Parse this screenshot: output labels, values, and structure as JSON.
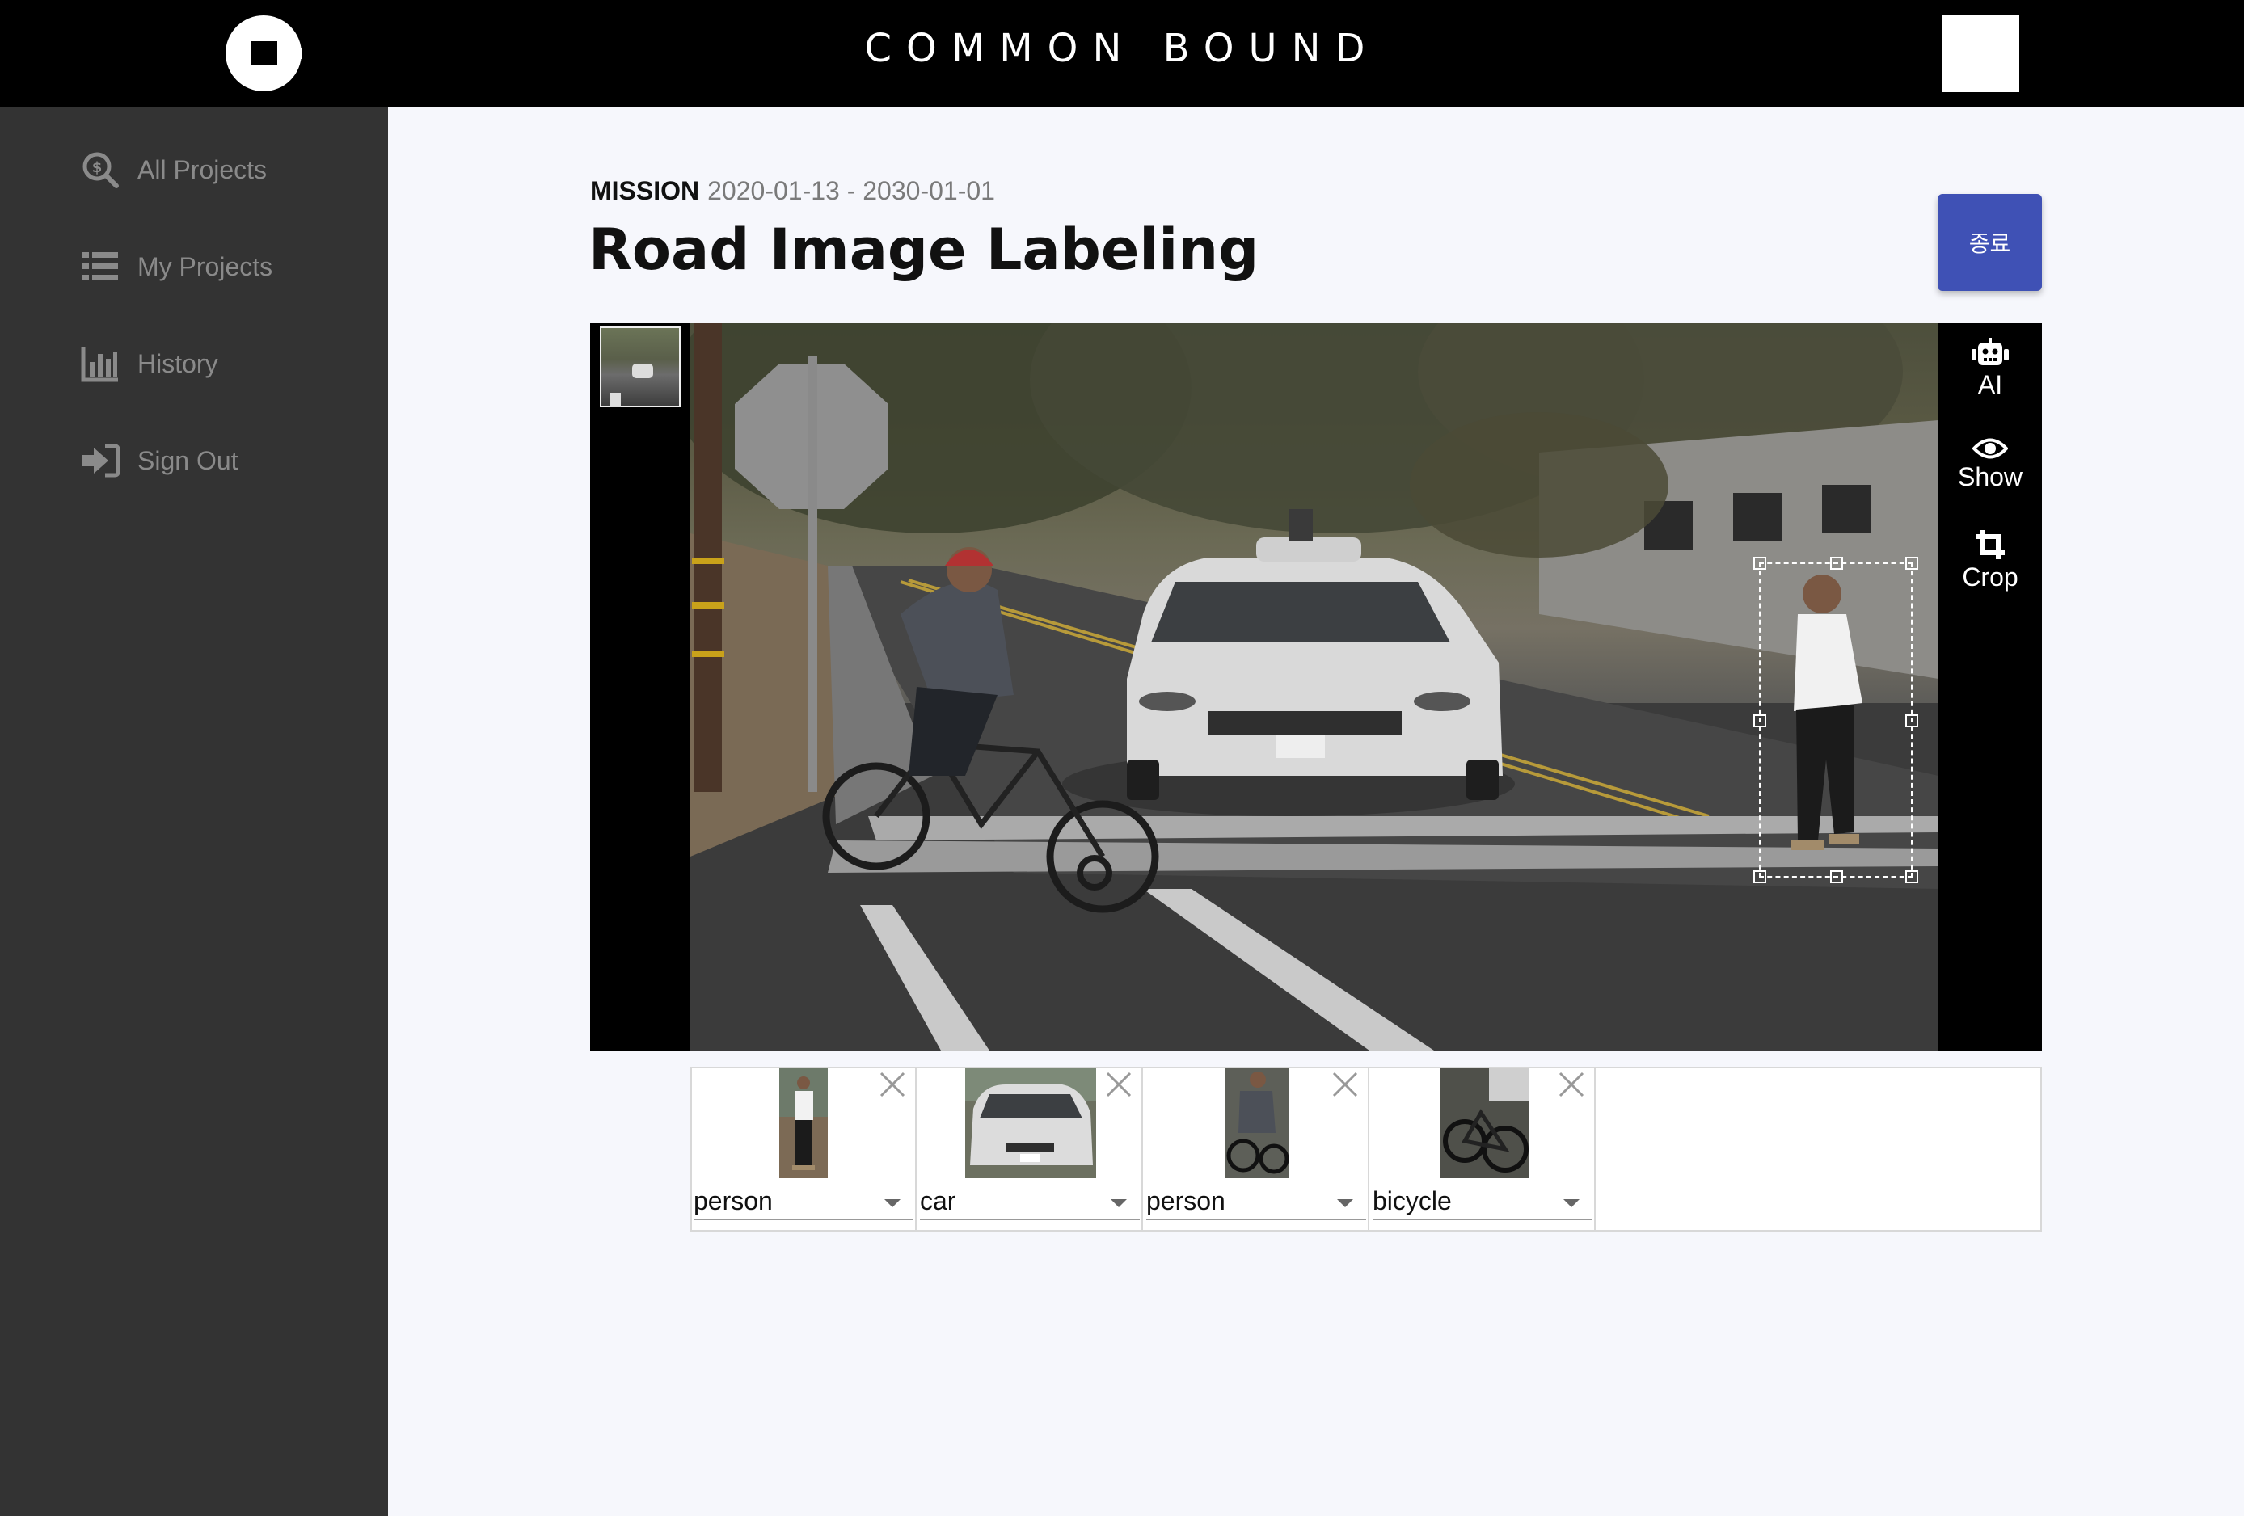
{
  "topbar": {
    "brand": "COMMON BOUND",
    "logo_icon": "logo-icon"
  },
  "sidebar": {
    "items": [
      {
        "label": "All Projects",
        "icon": "search-dollar-icon"
      },
      {
        "label": "My Projects",
        "icon": "list-icon"
      },
      {
        "label": "History",
        "icon": "bar-chart-icon"
      },
      {
        "label": "Sign Out",
        "icon": "sign-out-icon"
      }
    ]
  },
  "mission": {
    "tag": "MISSION",
    "dates": "2020-01-13 - 2030-01-01",
    "title": "Road Image Labeling",
    "end_label": "종료"
  },
  "tools": [
    {
      "label": "AI",
      "icon": "robot-icon"
    },
    {
      "label": "Show",
      "icon": "eye-icon"
    },
    {
      "label": "Crop",
      "icon": "crop-icon"
    }
  ],
  "labels": [
    {
      "name": "person"
    },
    {
      "name": "car"
    },
    {
      "name": "person"
    },
    {
      "name": "bicycle"
    }
  ],
  "colors": {
    "accent": "#3f51b5",
    "sidebar_bg": "#333333",
    "topbar_bg": "#000000"
  }
}
